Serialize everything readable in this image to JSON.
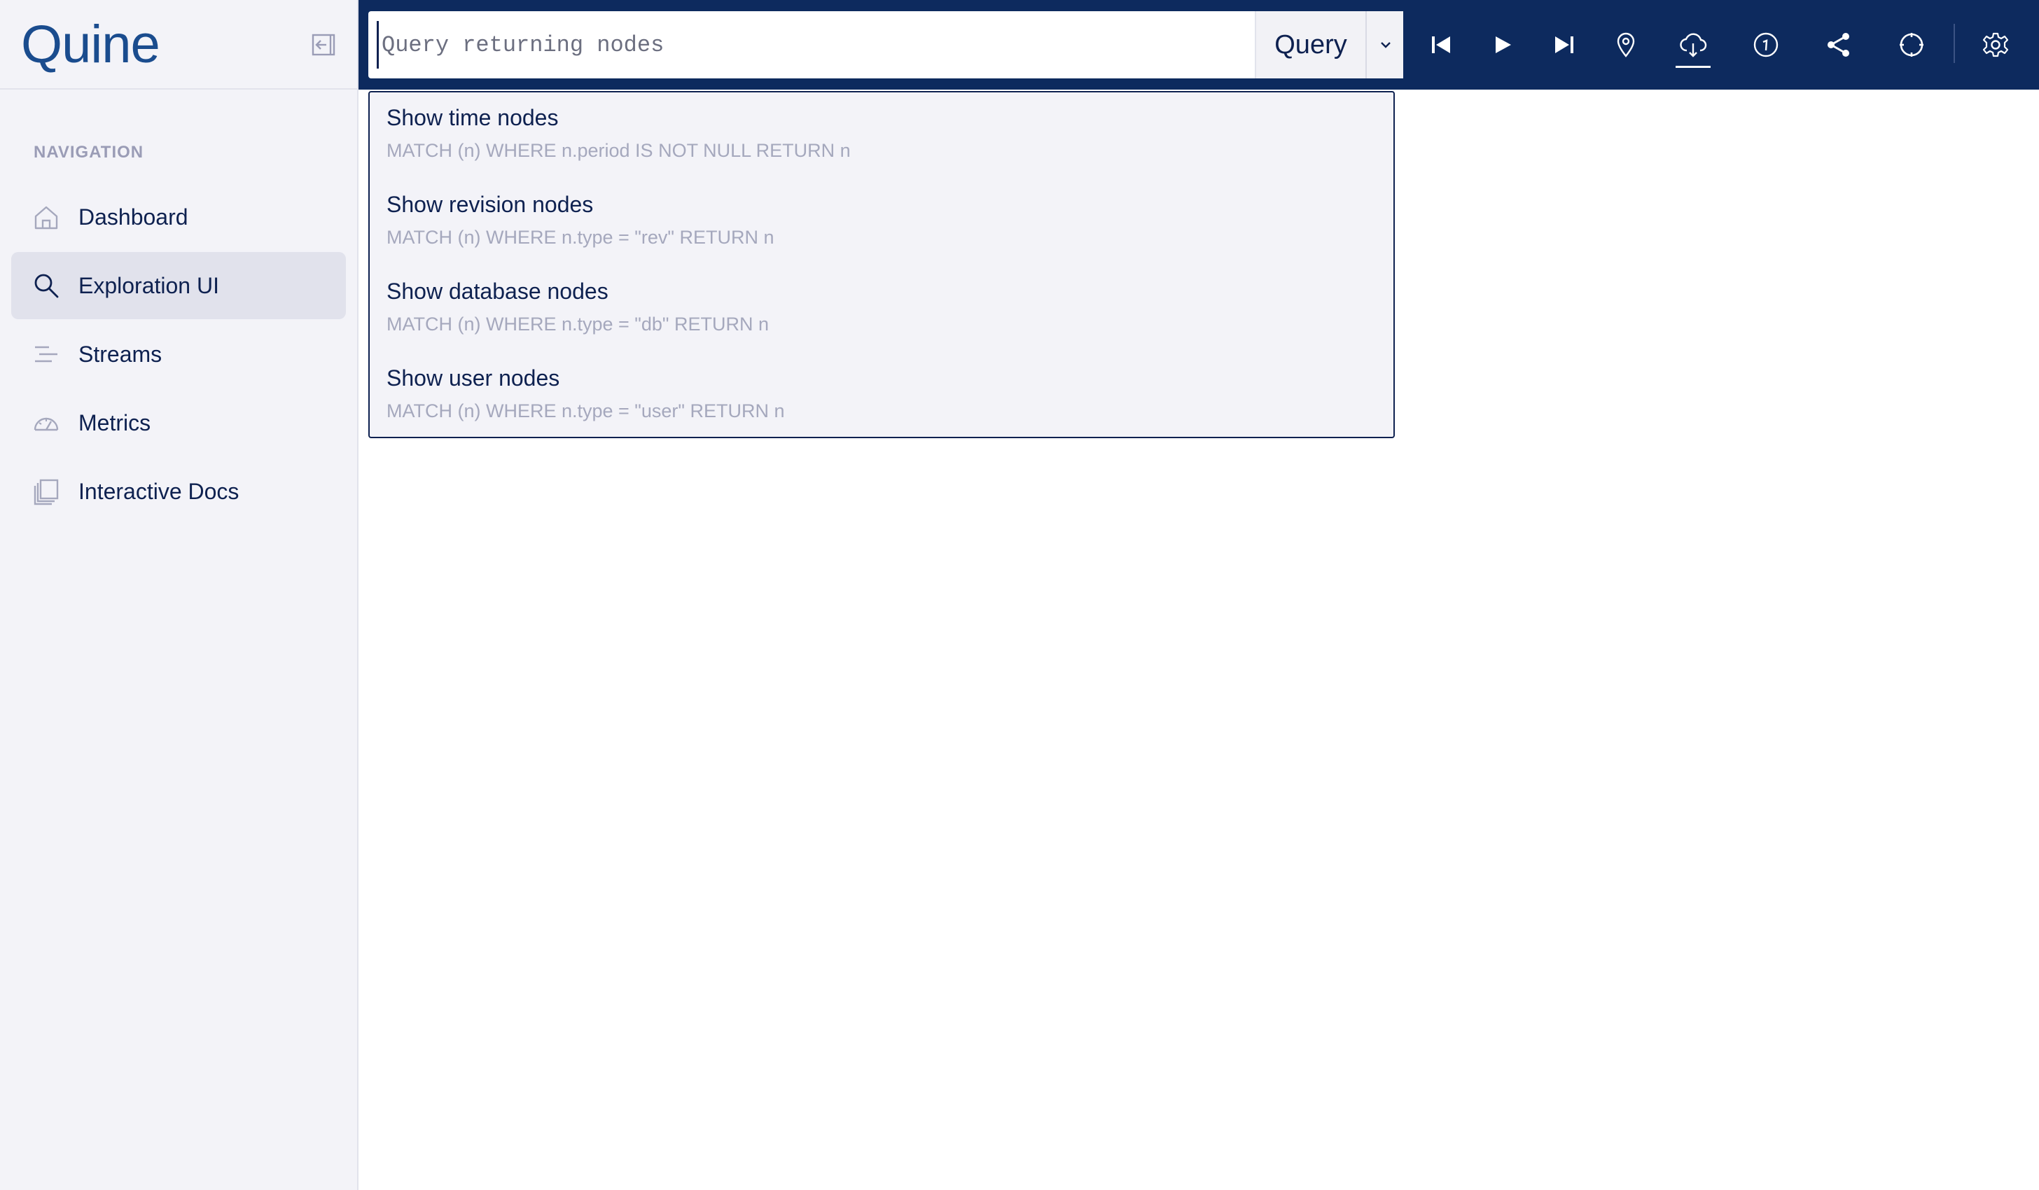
{
  "app": {
    "logo_text": "Quine"
  },
  "sidebar": {
    "heading": "NAVIGATION",
    "items": [
      {
        "label": "Dashboard",
        "icon": "home-icon",
        "active": false
      },
      {
        "label": "Exploration UI",
        "icon": "search-icon",
        "active": true
      },
      {
        "label": "Streams",
        "icon": "streams-icon",
        "active": false
      },
      {
        "label": "Metrics",
        "icon": "gauge-icon",
        "active": false
      },
      {
        "label": "Interactive Docs",
        "icon": "docs-icon",
        "active": false
      }
    ]
  },
  "topbar": {
    "query_placeholder": "Query returning nodes",
    "query_value": "",
    "query_button_label": "Query",
    "tools": [
      "skip-back-icon",
      "play-icon",
      "skip-forward-icon",
      "pin-icon",
      "cloud-download-icon",
      "info-icon",
      "share-icon",
      "recenter-icon",
      "settings-icon"
    ]
  },
  "suggestions": [
    {
      "title": "Show time nodes",
      "query": "MATCH (n) WHERE n.period IS NOT NULL RETURN n"
    },
    {
      "title": "Show revision nodes",
      "query": "MATCH (n) WHERE n.type = \"rev\" RETURN n"
    },
    {
      "title": "Show database nodes",
      "query": "MATCH (n) WHERE n.type = \"db\" RETURN n"
    },
    {
      "title": "Show user nodes",
      "query": "MATCH (n) WHERE n.type = \"user\" RETURN n"
    }
  ],
  "colors": {
    "topbar_bg": "#0d2a5e",
    "sidebar_bg": "#f3f3f8",
    "active_item_bg": "#e1e2ec",
    "text_primary": "#0e2150",
    "text_muted": "#a5a8bd",
    "brand": "#1a4c8e"
  }
}
